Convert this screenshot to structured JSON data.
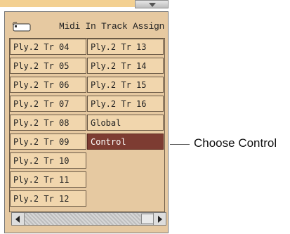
{
  "window": {
    "title": "Midi In Track Assign",
    "icon": "keyboard-icon"
  },
  "grid": {
    "left_column": [
      "Ply.2 Tr 04",
      "Ply.2 Tr 05",
      "Ply.2 Tr 06",
      "Ply.2 Tr 07",
      "Ply.2 Tr 08",
      "Ply.2 Tr 09",
      "Ply.2 Tr 10",
      "Ply.2 Tr 11",
      "Ply.2 Tr 12"
    ],
    "right_column": [
      "Ply.2 Tr 13",
      "Ply.2 Tr 14",
      "Ply.2 Tr 15",
      "Ply.2 Tr 16",
      "Global",
      "Control"
    ],
    "selected": "Control"
  },
  "callout": {
    "text": "Choose Control"
  },
  "colors": {
    "panel": "#e6c9a1",
    "cell": "#f1d6ad",
    "selected": "#7d3c32",
    "top_strip": "#f3d091"
  }
}
